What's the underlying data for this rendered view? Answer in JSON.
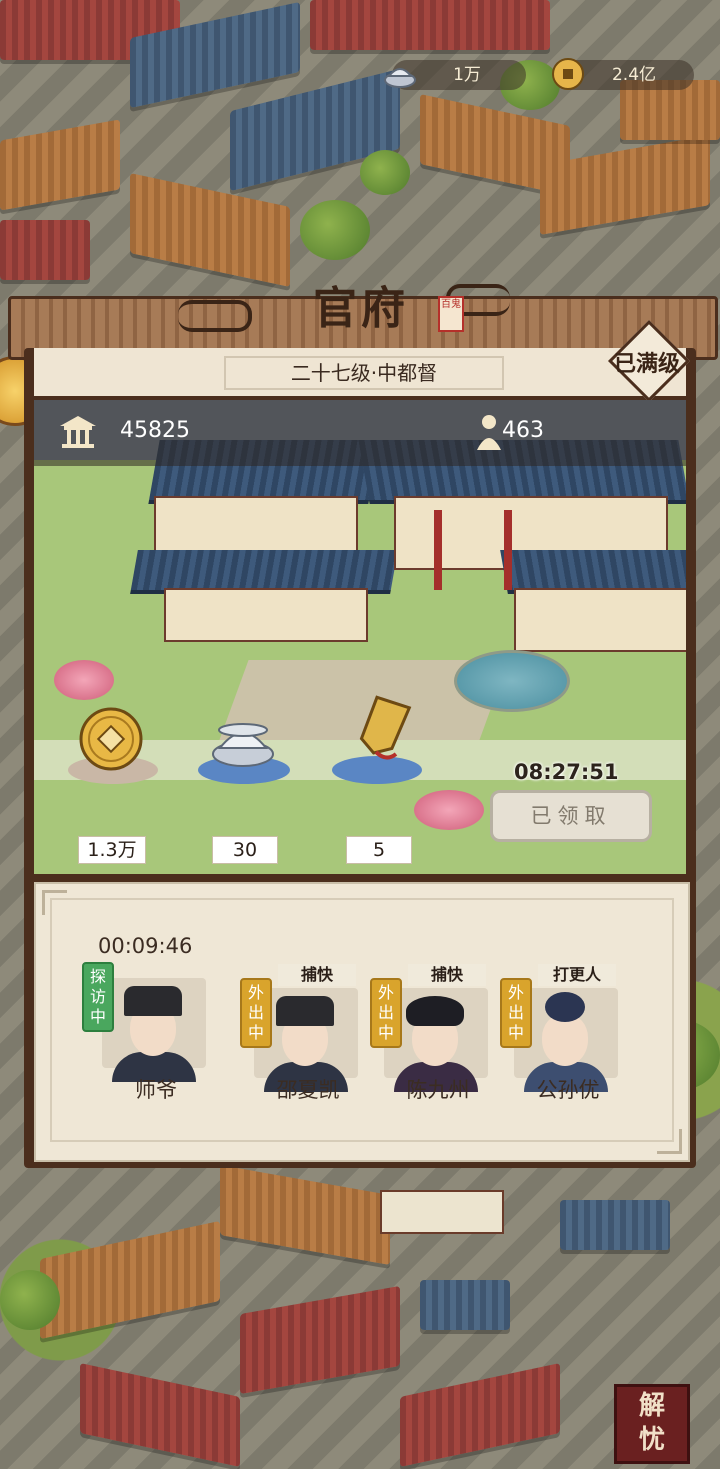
{
  "currency": {
    "silver": {
      "icon": "silver-ingot-icon",
      "value": "1万"
    },
    "coin": {
      "icon": "copper-coin-icon",
      "value": "2.4亿"
    }
  },
  "panel": {
    "title": "官府",
    "seal_text": "百鬼",
    "level": "二十七级·中都督",
    "max_badge": "已满级",
    "stats": {
      "prestige": {
        "icon": "pavilion-icon",
        "value": "45825"
      },
      "population": {
        "icon": "person-icon",
        "value": "463"
      }
    },
    "rewards": [
      {
        "icon": "copper-coin-icon",
        "count": "1.3万"
      },
      {
        "icon": "silver-ingot-icon",
        "count": "30"
      },
      {
        "icon": "token-icon",
        "count": "5"
      }
    ],
    "countdown": "08:27:51",
    "claim_button": "已领取"
  },
  "staff": {
    "timer": "00:09:46",
    "members": [
      {
        "name": "师爷",
        "role": "",
        "status": "探访中",
        "status_color": "#4aa75e"
      },
      {
        "name": "邵夏凯",
        "role": "捕快",
        "status": "外出中",
        "status_color": "#d9a42c"
      },
      {
        "name": "陈九州",
        "role": "捕快",
        "status": "外出中",
        "status_color": "#d9a42c"
      },
      {
        "name": "公孙优",
        "role": "打更人",
        "status": "外出中",
        "status_color": "#d9a42c"
      }
    ]
  },
  "bottom_button": "解忧",
  "colors": {
    "panel_frame": "#4b2e1d",
    "panel_bg": "#efe7d6",
    "roof_blue": "#3e5a7c",
    "status_gold": "#d9a42c",
    "status_green": "#4aa75e"
  }
}
